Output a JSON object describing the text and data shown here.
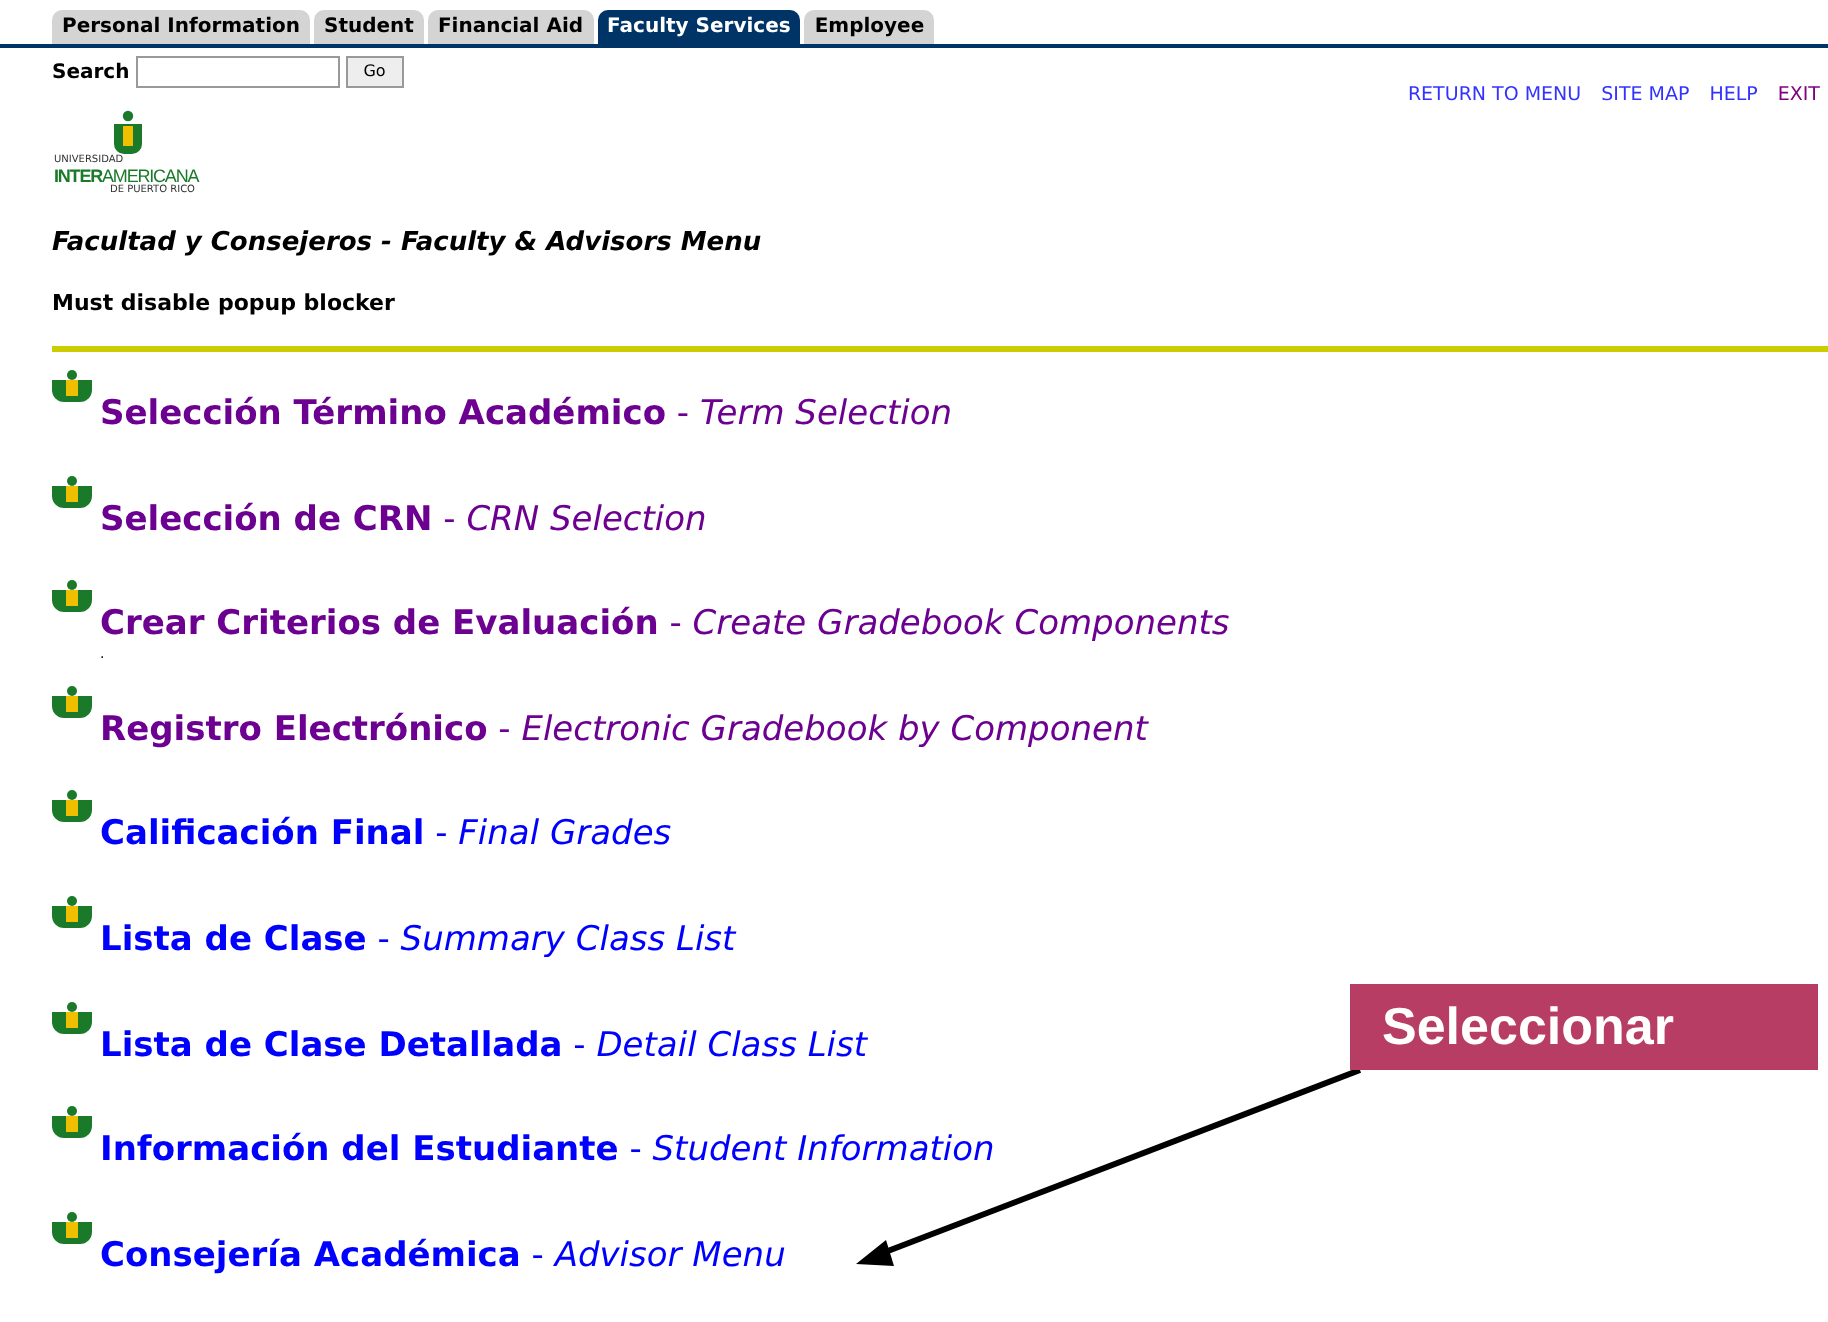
{
  "tabs": [
    {
      "label": "Personal Information",
      "selected": false
    },
    {
      "label": "Student",
      "selected": false
    },
    {
      "label": "Financial Aid",
      "selected": false
    },
    {
      "label": "Faculty Services",
      "selected": true
    },
    {
      "label": "Employee",
      "selected": false
    }
  ],
  "search": {
    "label": "Search",
    "button": "Go"
  },
  "top_links": [
    {
      "label": "RETURN TO MENU",
      "visited": false
    },
    {
      "label": "SITE MAP",
      "visited": false
    },
    {
      "label": "HELP",
      "visited": false
    },
    {
      "label": "EXIT",
      "visited": true
    }
  ],
  "logo": {
    "top": "UNIVERSIDAD",
    "name": "**INTER**AMERICANA",
    "bottom": "DE PUERTO RICO"
  },
  "page_title": "Facultad y Consejeros - Faculty & Advisors Menu",
  "notice": "Must disable popup blocker",
  "menu": [
    {
      "title": "Selección Término Académico",
      "subtitle": "Term Selection",
      "visited": true
    },
    {
      "title": "Selección de CRN",
      "subtitle": "CRN Selection",
      "visited": true
    },
    {
      "title": "Crear Criterios de Evaluación",
      "subtitle": "Create Gradebook Components",
      "visited": true,
      "note": "."
    },
    {
      "title": "Registro Electrónico",
      "subtitle": "Electronic Gradebook by Component",
      "visited": true
    },
    {
      "title": "Calificación Final",
      "subtitle": "Final Grades",
      "visited": false
    },
    {
      "title": "Lista de Clase",
      "subtitle": "Summary Class List",
      "visited": false
    },
    {
      "title": "Lista de Clase Detallada",
      "subtitle": "Detail Class List",
      "visited": false
    },
    {
      "title": "Información del Estudiante",
      "subtitle": "Student Information",
      "visited": false
    },
    {
      "title": "Consejería Académica",
      "subtitle": "Advisor Menu",
      "visited": false
    }
  ],
  "separator": "-",
  "callout": {
    "label": "Seleccionar"
  }
}
